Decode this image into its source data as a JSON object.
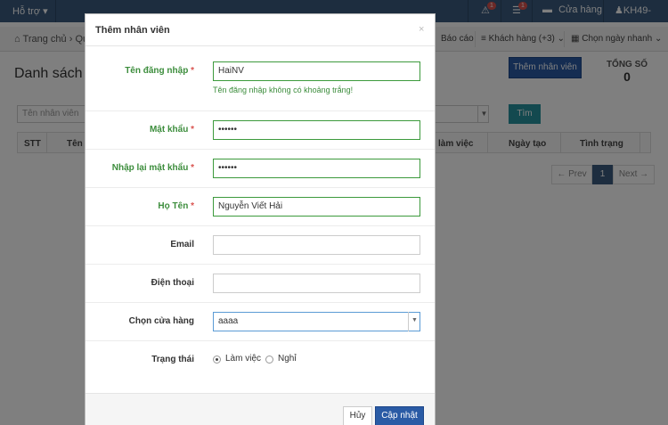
{
  "topbar": {
    "help": "Hỗ trợ",
    "alerts_badge": "1",
    "messages_badge": "1",
    "store": "Cửa hàng",
    "user": "KH49-"
  },
  "breadcrumb": {
    "home": "Trang chủ",
    "next": "Qu"
  },
  "toolbar": {
    "report": "Báo cáo",
    "customers": "Khách hàng (+3)",
    "date": "Chọn ngày nhanh"
  },
  "page": {
    "title": "Danh sách nh",
    "add_button": "Thêm nhân viên",
    "total_label": "TỔNG SỐ",
    "total_value": "0",
    "search_placeholder": "Tên nhân viên",
    "find_button": "Tìm"
  },
  "table": {
    "headers": [
      "STT",
      "Tên",
      "làm việc",
      "Ngày tạo",
      "Tình trạng"
    ]
  },
  "pagination": {
    "prev": "← Prev",
    "current": "1",
    "next": "Next →"
  },
  "modal": {
    "title": "Thêm nhân viên",
    "close": "×",
    "username_label": "Tên đăng nhập",
    "username_value": "HaiNV",
    "username_hint": "Tên đăng nhập không có khoảng trắng!",
    "password_label": "Mật khẩu",
    "password_value": "••••••",
    "confirm_label": "Nhập lại mật khẩu",
    "confirm_value": "••••••",
    "fullname_label": "Họ Tên",
    "fullname_value": "Nguyễn Viết Hải",
    "email_label": "Email",
    "email_value": "",
    "phone_label": "Điện thoại",
    "phone_value": "",
    "store_label": "Chọn cửa hàng",
    "store_value": "aaaa",
    "status_label": "Trạng thái",
    "status_working": "Làm việc",
    "status_off": "Nghỉ",
    "required_mark": "*",
    "cancel_button": "Hủy",
    "save_button": "Cập nhật"
  }
}
